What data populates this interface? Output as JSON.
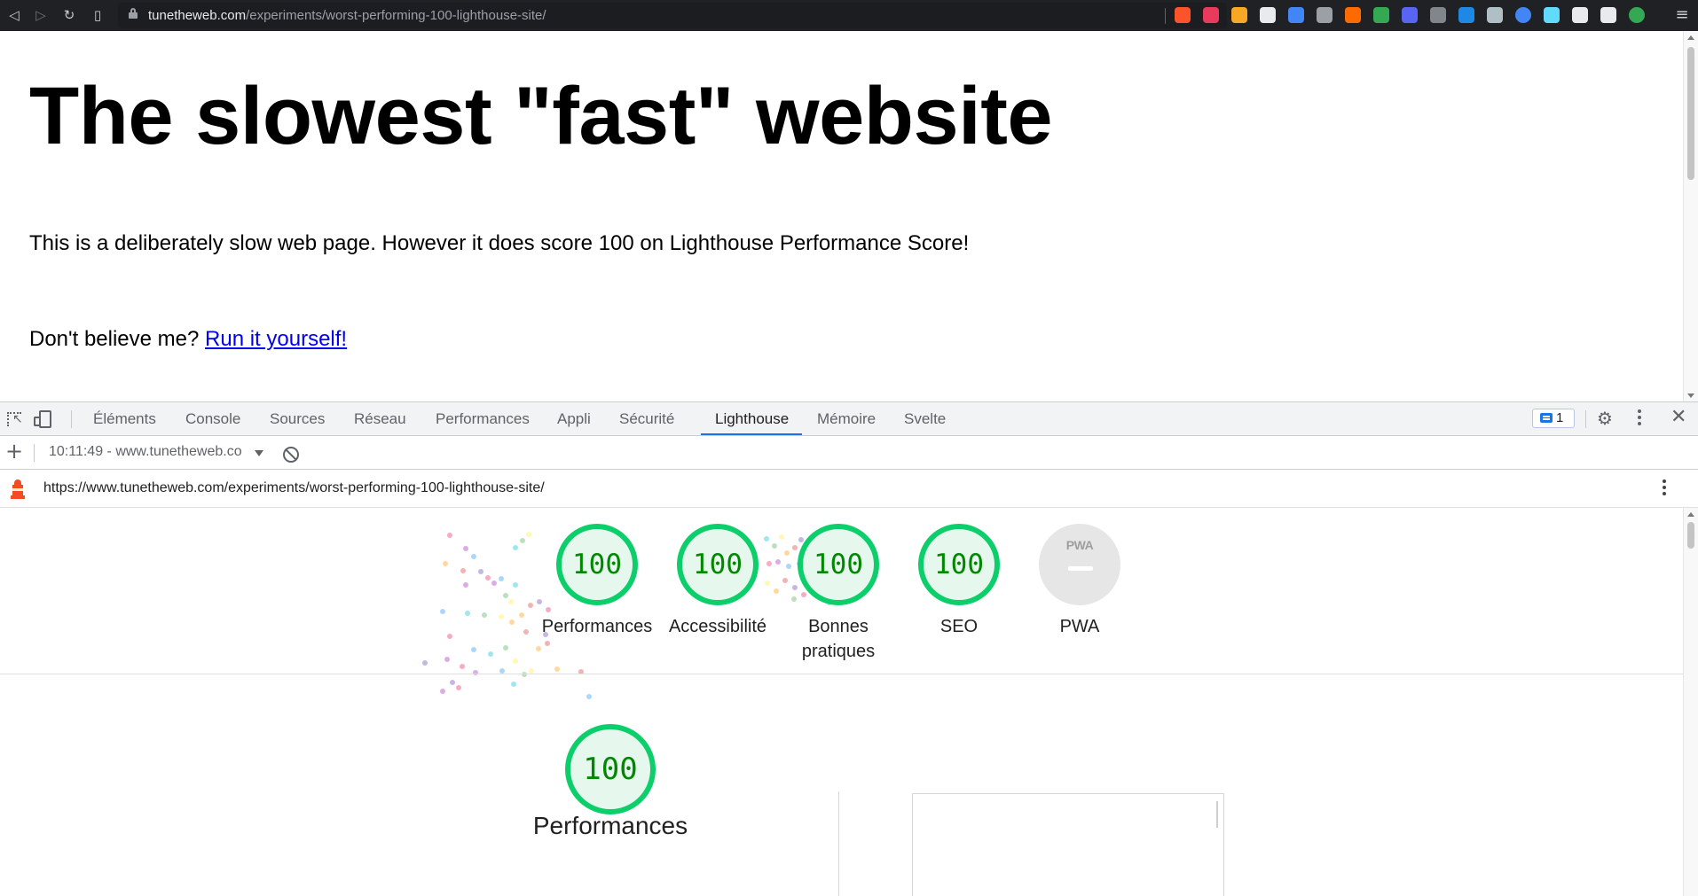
{
  "browser": {
    "url_domain": "tunetheweb.com",
    "url_path": "/experiments/worst-performing-100-lighthouse-site/",
    "nav_icons": [
      "back-icon",
      "forward-icon",
      "reload-icon",
      "bookmark-icon"
    ],
    "extension_colors": [
      "#fb542b",
      "#e83a5c",
      "#f9a825",
      "#e8eaed",
      "#4285f4",
      "#9aa0a6",
      "#ff6a00",
      "#34a853",
      "#5865f2",
      "#80868b",
      "#1e88e5",
      "#b0bec5",
      "#4285f4",
      "#61dafb",
      "#e8eaed",
      "#e8eaed",
      "#34a853"
    ],
    "menu_icon": "hamburger-icon"
  },
  "page": {
    "title": "The slowest \"fast\" website",
    "intro": "This is a deliberately slow web page. However it does score 100 on Lighthouse Performance Score!",
    "cta_prefix": "Don't believe me? ",
    "cta_link": "Run it yourself!"
  },
  "devtools": {
    "tabs": [
      "Éléments",
      "Console",
      "Sources",
      "Réseau",
      "Performances",
      "Appli",
      "Sécurité",
      "Lighthouse",
      "Mémoire",
      "Svelte"
    ],
    "active_tab": "Lighthouse",
    "issues_count": "1",
    "report_select": "10:11:49 - www.tunetheweb.co",
    "report_url": "https://www.tunetheweb.com/experiments/worst-performing-100-lighthouse-site/"
  },
  "lighthouse": {
    "accent_pass": "#0cce6b",
    "gauges": [
      {
        "label": "Performances",
        "score": "100"
      },
      {
        "label": "Accessibilité",
        "score": "100"
      },
      {
        "label": "Bonnes pratiques",
        "score": "100"
      },
      {
        "label": "SEO",
        "score": "100"
      }
    ],
    "pwa": {
      "badge": "PWA",
      "label": "PWA"
    },
    "main_score": "100",
    "main_label": "Performances"
  }
}
